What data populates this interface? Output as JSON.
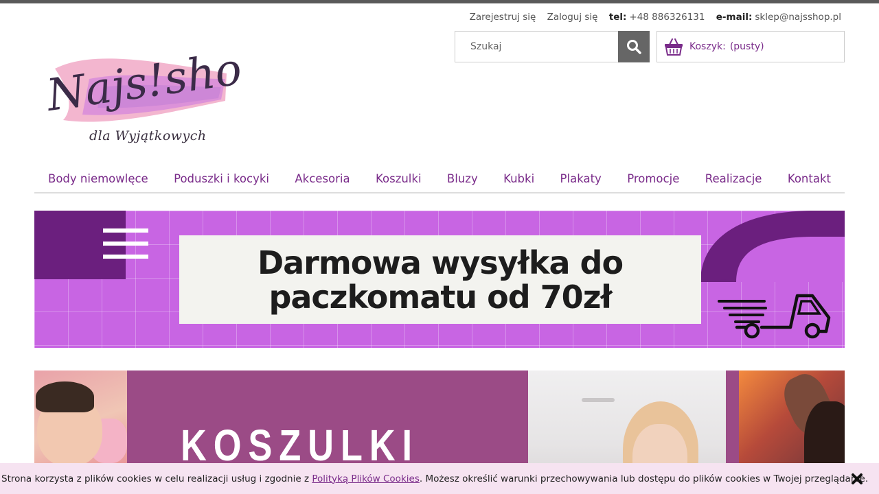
{
  "header": {
    "register_link": "Zarejestruj się",
    "login_link": "Zaloguj się",
    "tel_label": "tel:",
    "tel_value": "+48 886326131",
    "email_label": "e-mail:",
    "email_value": "sklep@najsshop.pl"
  },
  "logo": {
    "brand_text": "Najs!shop",
    "tagline": "dla Wyjątkowych"
  },
  "search": {
    "placeholder": "Szukaj",
    "button_icon": "search-icon"
  },
  "cart": {
    "icon": "basket-icon",
    "label": "Koszyk:",
    "value": "(pusty)"
  },
  "nav": {
    "items": [
      {
        "label": "Body niemowlęce"
      },
      {
        "label": "Poduszki i kocyki"
      },
      {
        "label": "Akcesoria"
      },
      {
        "label": "Koszulki"
      },
      {
        "label": "Bluzy"
      },
      {
        "label": "Kubki"
      },
      {
        "label": "Plakaty"
      },
      {
        "label": "Promocje"
      },
      {
        "label": "Realizacje"
      },
      {
        "label": "Kontakt"
      }
    ]
  },
  "banner_shipping": {
    "line1": "Darmowa wysyłka do",
    "line2": "paczkomatu od 70zł",
    "icon": "delivery-truck-icon"
  },
  "banner_category": {
    "title": "KOSZULKI"
  },
  "cookies": {
    "text_before": "Strona korzysta z plików cookies w celu realizacji usług i zgodnie z ",
    "link_text": "Polityką Plików Cookies",
    "text_after": ". Możesz określić warunki przechowywania lub dostępu do plików cookies w Twojej przeglądarce.",
    "close_icon": "close-icon"
  },
  "colors": {
    "accent": "#7a2c8a",
    "banner_purple": "#c865e3",
    "banner_dark": "#6b1f7e",
    "category_bg": "#9b4b86",
    "cookie_bg": "#f6e3f1"
  }
}
